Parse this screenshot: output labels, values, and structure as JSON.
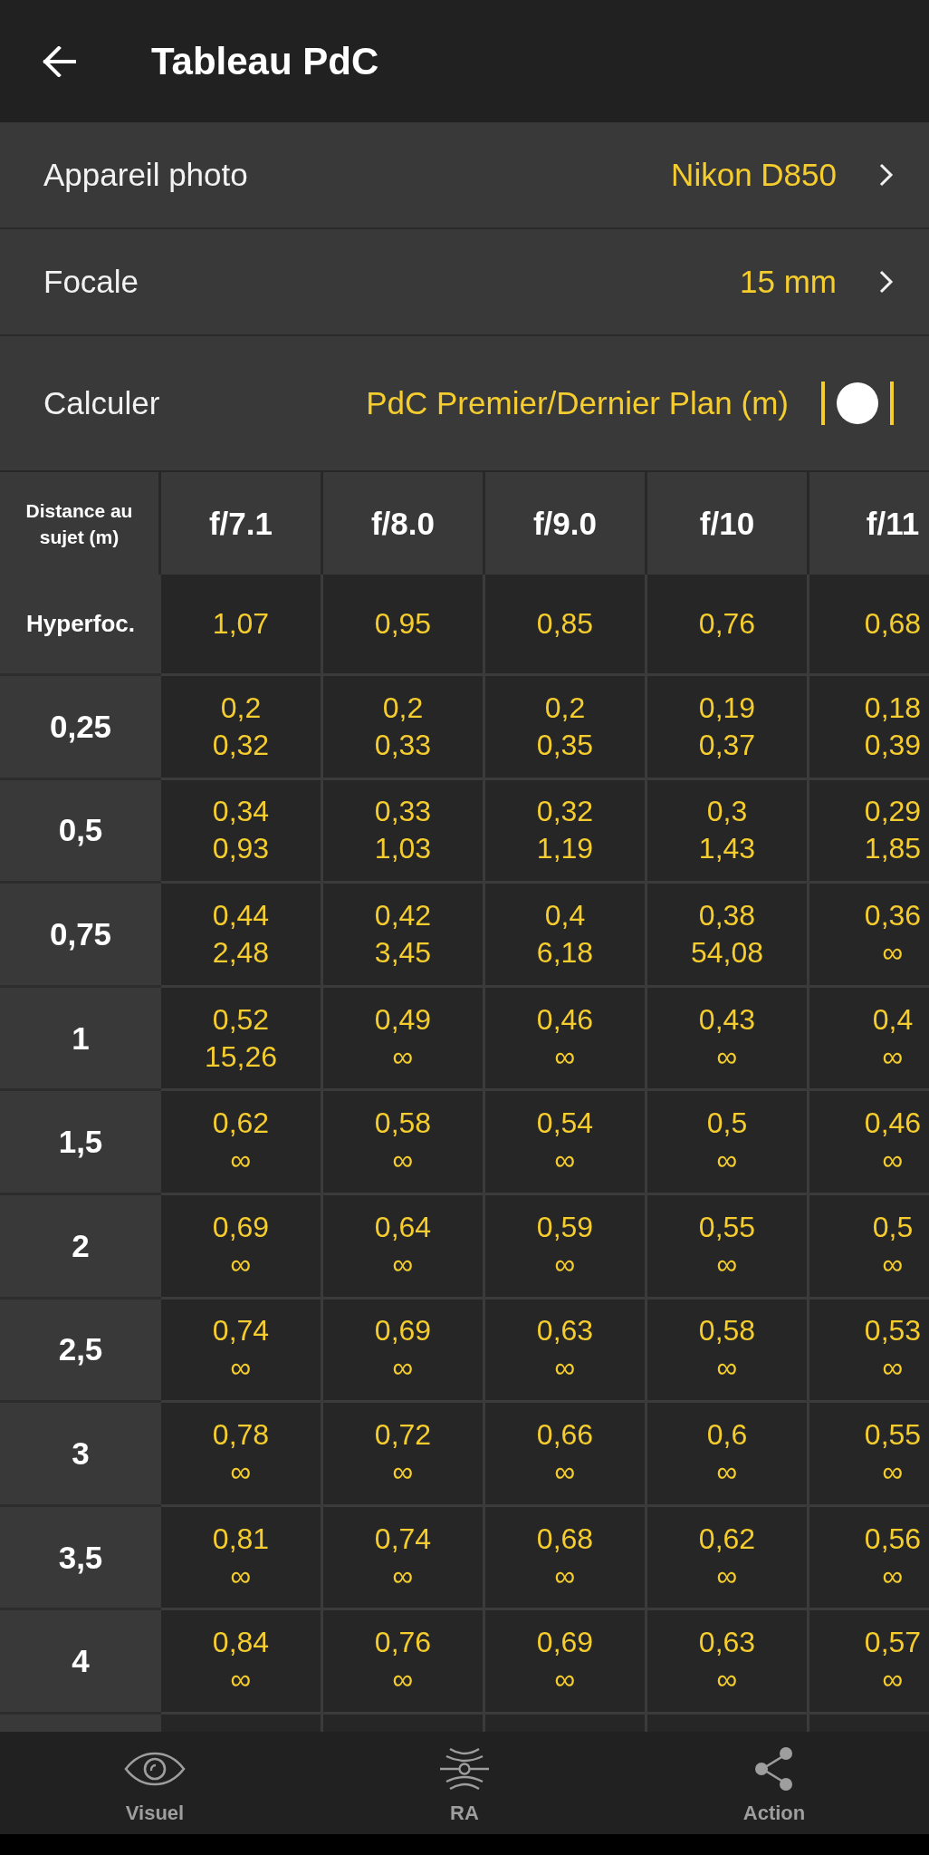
{
  "app_bar": {
    "title": "Tableau PdC"
  },
  "settings": [
    {
      "label": "Appareil photo",
      "value": "Nikon D850",
      "kind": "link"
    },
    {
      "label": "Focale",
      "value": "15 mm",
      "kind": "link"
    },
    {
      "label": "Calculer",
      "value": "PdC Premier/Dernier Plan (m)",
      "kind": "toggle"
    }
  ],
  "table": {
    "corner_label": "Distance au sujet (m)",
    "columns": [
      "f/7.1",
      "f/8.0",
      "f/9.0",
      "f/10",
      "f/11"
    ],
    "rows": [
      {
        "label": "Hyperfoc.",
        "kind": "hyperfocal",
        "cells": [
          [
            "1,07"
          ],
          [
            "0,95"
          ],
          [
            "0,85"
          ],
          [
            "0,76"
          ],
          [
            "0,68"
          ]
        ]
      },
      {
        "label": "0,25",
        "kind": "distance",
        "cells": [
          [
            "0,2",
            "0,32"
          ],
          [
            "0,2",
            "0,33"
          ],
          [
            "0,2",
            "0,35"
          ],
          [
            "0,19",
            "0,37"
          ],
          [
            "0,18",
            "0,39"
          ]
        ]
      },
      {
        "label": "0,5",
        "kind": "distance",
        "cells": [
          [
            "0,34",
            "0,93"
          ],
          [
            "0,33",
            "1,03"
          ],
          [
            "0,32",
            "1,19"
          ],
          [
            "0,3",
            "1,43"
          ],
          [
            "0,29",
            "1,85"
          ]
        ]
      },
      {
        "label": "0,75",
        "kind": "distance",
        "cells": [
          [
            "0,44",
            "2,48"
          ],
          [
            "0,42",
            "3,45"
          ],
          [
            "0,4",
            "6,18"
          ],
          [
            "0,38",
            "54,08"
          ],
          [
            "0,36",
            "∞"
          ]
        ]
      },
      {
        "label": "1",
        "kind": "distance",
        "cells": [
          [
            "0,52",
            "15,26"
          ],
          [
            "0,49",
            "∞"
          ],
          [
            "0,46",
            "∞"
          ],
          [
            "0,43",
            "∞"
          ],
          [
            "0,4",
            "∞"
          ]
        ]
      },
      {
        "label": "1,5",
        "kind": "distance",
        "cells": [
          [
            "0,62",
            "∞"
          ],
          [
            "0,58",
            "∞"
          ],
          [
            "0,54",
            "∞"
          ],
          [
            "0,5",
            "∞"
          ],
          [
            "0,46",
            "∞"
          ]
        ]
      },
      {
        "label": "2",
        "kind": "distance",
        "cells": [
          [
            "0,69",
            "∞"
          ],
          [
            "0,64",
            "∞"
          ],
          [
            "0,59",
            "∞"
          ],
          [
            "0,55",
            "∞"
          ],
          [
            "0,5",
            "∞"
          ]
        ]
      },
      {
        "label": "2,5",
        "kind": "distance",
        "cells": [
          [
            "0,74",
            "∞"
          ],
          [
            "0,69",
            "∞"
          ],
          [
            "0,63",
            "∞"
          ],
          [
            "0,58",
            "∞"
          ],
          [
            "0,53",
            "∞"
          ]
        ]
      },
      {
        "label": "3",
        "kind": "distance",
        "cells": [
          [
            "0,78",
            "∞"
          ],
          [
            "0,72",
            "∞"
          ],
          [
            "0,66",
            "∞"
          ],
          [
            "0,6",
            "∞"
          ],
          [
            "0,55",
            "∞"
          ]
        ]
      },
      {
        "label": "3,5",
        "kind": "distance",
        "cells": [
          [
            "0,81",
            "∞"
          ],
          [
            "0,74",
            "∞"
          ],
          [
            "0,68",
            "∞"
          ],
          [
            "0,62",
            "∞"
          ],
          [
            "0,56",
            "∞"
          ]
        ]
      },
      {
        "label": "4",
        "kind": "distance",
        "cells": [
          [
            "0,84",
            "∞"
          ],
          [
            "0,76",
            "∞"
          ],
          [
            "0,69",
            "∞"
          ],
          [
            "0,63",
            "∞"
          ],
          [
            "0,57",
            "∞"
          ]
        ]
      }
    ]
  },
  "bottom_nav": [
    {
      "label": "Visuel"
    },
    {
      "label": "RA"
    },
    {
      "label": "Action"
    }
  ]
}
